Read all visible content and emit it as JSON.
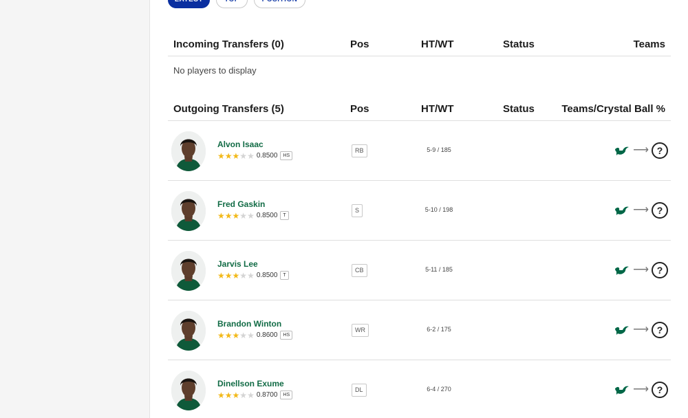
{
  "filters": [
    {
      "label": "Latest",
      "active": true
    },
    {
      "label": "Top",
      "active": false
    },
    {
      "label": "Position",
      "active": false
    }
  ],
  "incoming": {
    "title": "Incoming Transfers (0)",
    "columns": {
      "pos": "Pos",
      "htwt": "HT/WT",
      "status": "Status",
      "teams": "Teams"
    },
    "empty_message": "No players to display"
  },
  "outgoing": {
    "title": "Outgoing Transfers (5)",
    "columns": {
      "pos": "Pos",
      "htwt": "HT/WT",
      "status": "Status",
      "teams": "Teams/Crystal Ball %"
    },
    "players": [
      {
        "name": "Alvon Isaac",
        "stars": 3,
        "rating": "0.8500",
        "level": "HS",
        "pos": "RB",
        "htwt": "5-9 / 185",
        "team_icon": "usf-bull-logo-icon",
        "destination_icon": "unknown-question-icon"
      },
      {
        "name": "Fred Gaskin",
        "stars": 3,
        "rating": "0.8500",
        "level": "T",
        "pos": "S",
        "htwt": "5-10 / 198",
        "team_icon": "usf-bull-logo-icon",
        "destination_icon": "unknown-question-icon"
      },
      {
        "name": "Jarvis Lee",
        "stars": 3,
        "rating": "0.8500",
        "level": "T",
        "pos": "CB",
        "htwt": "5-11 / 185",
        "team_icon": "usf-bull-logo-icon",
        "destination_icon": "unknown-question-icon"
      },
      {
        "name": "Brandon Winton",
        "stars": 3,
        "rating": "0.8600",
        "level": "HS",
        "pos": "WR",
        "htwt": "6-2 / 175",
        "team_icon": "usf-bull-logo-icon",
        "destination_icon": "unknown-question-icon"
      },
      {
        "name": "Dinellson Exume",
        "stars": 3,
        "rating": "0.8700",
        "level": "HS",
        "pos": "DL",
        "htwt": "6-4 / 270",
        "team_icon": "usf-bull-logo-icon",
        "destination_icon": "unknown-question-icon"
      }
    ]
  },
  "colors": {
    "accent": "#0a2fa0",
    "player_name": "#116b45",
    "star_on": "#f2b91a",
    "usf_green": "#006747"
  }
}
